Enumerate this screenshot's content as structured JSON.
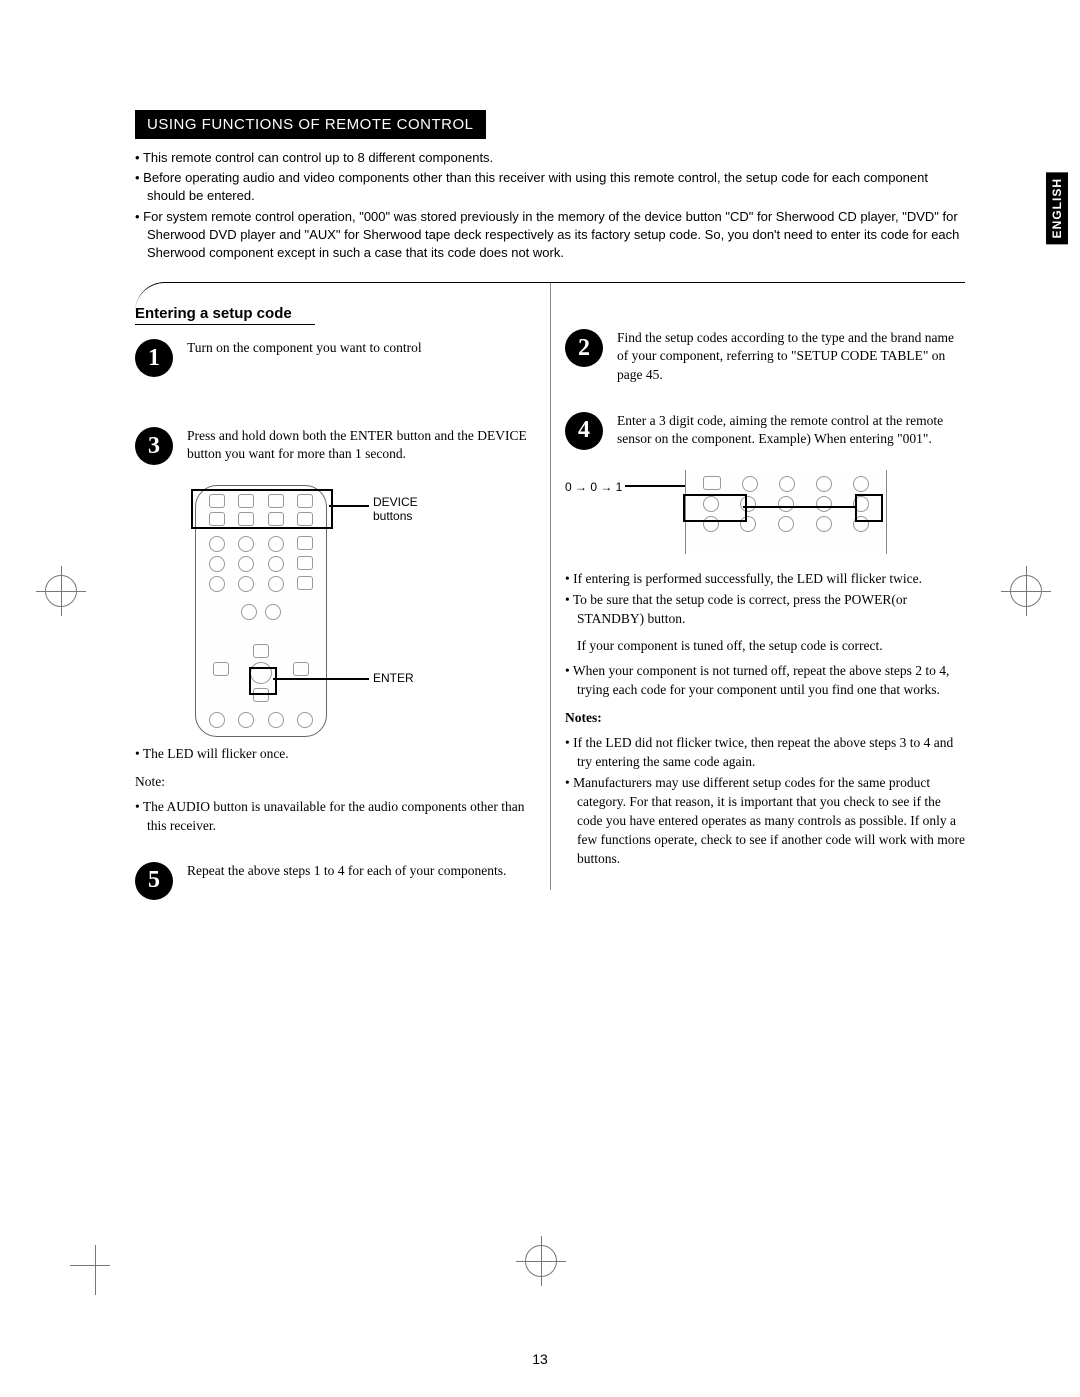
{
  "language_tab": "ENGLISH",
  "section_header": "USING FUNCTIONS OF REMOTE CONTROL",
  "intro_bullets": [
    "This remote control can control up to 8 different components.",
    "Before operating audio and video components other than this receiver with using this remote control, the setup code for each component should be entered.",
    "For system remote control operation, \"000\" was stored previously in the memory of the device button \"CD\" for Sherwood CD player, \"DVD\" for Sherwood DVD player and \"AUX\" for Sherwood tape deck respectively as its factory setup code. So, you don't need to enter its code for each Sherwood component except in such a case that its code does not work."
  ],
  "subsection_title": "Entering a setup code",
  "steps": {
    "s1": "Turn on the component you want to control",
    "s2": "Find the setup codes according to the type and the brand name of your component, referring to \"SETUP CODE TABLE\" on page 45.",
    "s3": "Press and hold down both the ENTER button and the DEVICE button you want for more than 1 second.",
    "s4": "Enter a 3 digit code, aiming the remote control at the remote sensor on the component. Example) When entering \"001\".",
    "s5": "Repeat the above steps 1 to 4 for each of your components."
  },
  "callouts": {
    "device_buttons": "DEVICE buttons",
    "enter": "ENTER",
    "example_seq": "0 → 0 → 1"
  },
  "left_extra": {
    "led_once": "The LED will flicker once.",
    "note_label": "Note:",
    "audio_note": "The AUDIO button is unavailable for the audio components other than this receiver."
  },
  "right_bullets": [
    "If entering is performed successfully, the LED will flicker twice.",
    "To be sure that the setup code is correct, press the POWER(or STANDBY) button.",
    "When your component is not turned off, repeat the above steps 2 to 4, trying each code for your component until you find one that works."
  ],
  "right_plain": "If your component is tuned off, the setup code is correct.",
  "notes_label": "Notes:",
  "notes_bullets": [
    "If the LED did not flicker twice, then repeat the above steps 3 to 4 and try entering the same code again.",
    "Manufacturers may use different setup codes for the same product category. For that reason, it is important that you check to see if the code you have entered operates as many controls as possible. If only a few functions operate, check to see if another code will work with more buttons."
  ],
  "page_number": "13"
}
